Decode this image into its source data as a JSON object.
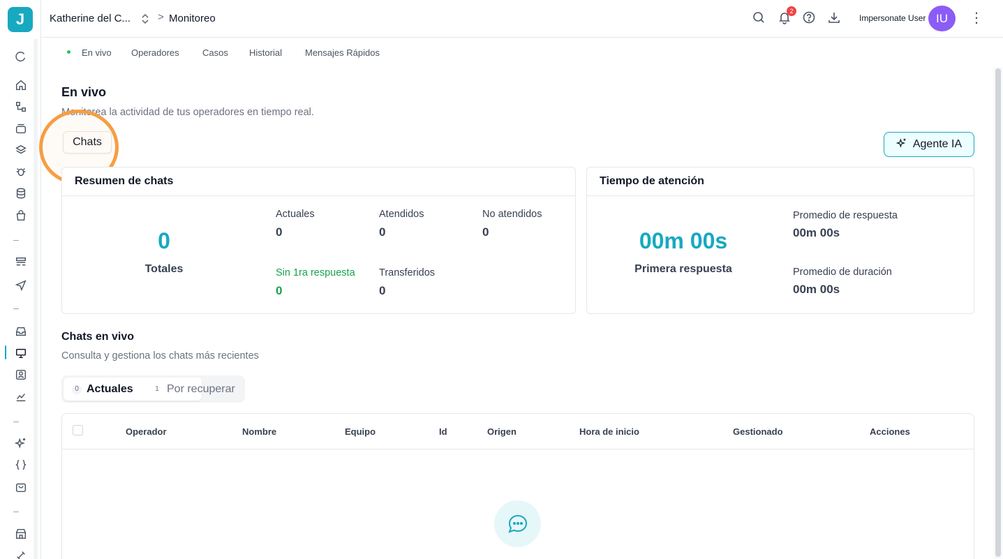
{
  "colors": {
    "accent": "#17a9c0",
    "avatar": "#8b5cf6",
    "badge": "#ef4444",
    "live": "#22c55e",
    "highlight": "#f59e44",
    "green": "#16a34a"
  },
  "sidebar": {
    "logo": "J",
    "icons": [
      "refresh-icon",
      "home-icon",
      "flow-icon",
      "archive-icon",
      "layers-icon",
      "bug-icon",
      "database-icon",
      "shopping-bag-icon",
      "forms-icon",
      "send-icon",
      "inbox-icon",
      "monitor-icon",
      "contact-icon",
      "analytics-icon",
      "sparkles-icon",
      "code-braces-icon",
      "store-bag-icon",
      "storefront-icon",
      "plug-icon"
    ]
  },
  "header": {
    "workspace": "Katherine del C...",
    "separator": ">",
    "current": "Monitoreo",
    "notifications_count": "2",
    "impersonate": "Impersonate User",
    "avatar_initials": "IU",
    "more": "⋮"
  },
  "subtabs": [
    "En vivo",
    "Operadores",
    "Casos",
    "Historial",
    "Mensajes Rápidos"
  ],
  "page": {
    "title": "En vivo",
    "subtitle": "Monitorea la actividad de tus operadores en tiempo real.",
    "chats_tab": "Chats",
    "agent_button": "Agente IA"
  },
  "summary": {
    "title": "Resumen de chats",
    "total_value": "0",
    "total_label": "Totales",
    "stats": {
      "actuales_label": "Actuales",
      "actuales_value": "0",
      "atendidos_label": "Atendidos",
      "atendidos_value": "0",
      "no_atendidos_label": "No atendidos",
      "no_atendidos_value": "0",
      "sin_label": "Sin 1ra respuesta",
      "sin_value": "0",
      "transferidos_label": "Transferidos",
      "transferidos_value": "0"
    }
  },
  "attention": {
    "title": "Tiempo de atención",
    "first_value": "00m 00s",
    "first_label": "Primera respuesta",
    "avg_response_label": "Promedio de respuesta",
    "avg_response_value": "00m 00s",
    "avg_duration_label": "Promedio de duración",
    "avg_duration_value": "00m 00s"
  },
  "live_chats": {
    "title": "Chats en vivo",
    "subtitle": "Consulta y gestiona los chats más recientes",
    "segments": [
      {
        "count": "0",
        "label": "Actuales"
      },
      {
        "count": "1",
        "label": "Por recuperar"
      }
    ],
    "columns": [
      "Operador",
      "Nombre",
      "Equipo",
      "Id",
      "Origen",
      "Hora de inicio",
      "Gestionado",
      "Acciones"
    ]
  }
}
